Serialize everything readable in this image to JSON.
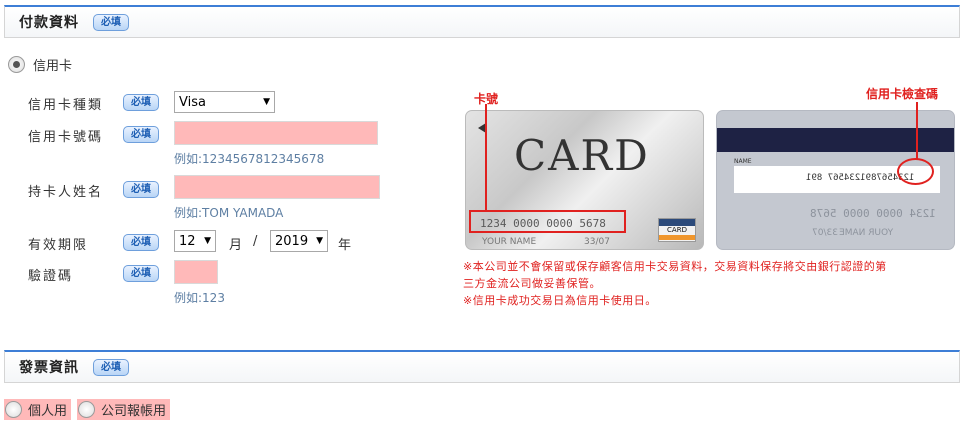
{
  "payment": {
    "title": "付款資料",
    "required": "必填",
    "method_label": "信用卡",
    "card_type": {
      "label": "信用卡種類",
      "value": "Visa"
    },
    "card_number": {
      "label": "信用卡號碼",
      "value": "",
      "hint": "例如:1234567812345678"
    },
    "holder": {
      "label": "持卡人姓名",
      "value": "",
      "hint": "例如:TOM YAMADA"
    },
    "expiry": {
      "label": "有效期限",
      "month": "12",
      "month_unit": "月",
      "separator": "/",
      "year": "2019",
      "year_unit": "年"
    },
    "cvv": {
      "label": "驗證碼",
      "value": "",
      "hint": "例如:123"
    }
  },
  "card_illustration": {
    "front_text": "CARD",
    "front_number": "1234 0000 0000 5678",
    "front_name": "YOUR NAME",
    "front_exp": "33/07",
    "front_logo": "CARD",
    "number_callout": "卡號",
    "cvv_callout": "信用卡檢查碼",
    "back_sig_name": "NAME",
    "back_digits": "1234567891234567 891",
    "back_mirror_number": "1234 0000 0000 5678",
    "back_mirror_name": "YOUR NAME",
    "back_mirror_exp": "33/07"
  },
  "notices": [
    "※本公司並不會保留或保存顧客信用卡交易資料，交易資料保存將交由銀行認證的第",
    "三方金流公司做妥善保管。",
    "※信用卡成功交易日為信用卡使用日。"
  ],
  "invoice": {
    "title": "發票資訊",
    "required": "必填",
    "options": [
      "個人用",
      "公司報帳用"
    ]
  },
  "colors": {
    "accent_blue": "#3d7ed6",
    "error_pink": "#ffb9b9",
    "callout_red": "#e0211f",
    "hint_blue": "#5e7fa3"
  }
}
